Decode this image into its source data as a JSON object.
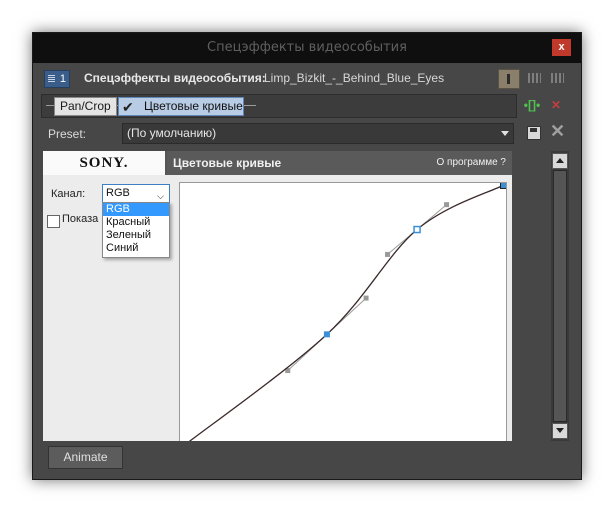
{
  "window": {
    "title": "Спецэффекты видеособытия",
    "close_label": "x"
  },
  "header": {
    "fx_badge_label": "1",
    "title": "Спецэффекты видеособытия:",
    "event_name": "Limp_Bizkit_-_Behind_Blue_Eyes"
  },
  "chain": {
    "plugins": [
      {
        "label": "Pan/Crop"
      },
      {
        "label": "Цветовые кривые"
      }
    ]
  },
  "preset": {
    "label": "Preset:",
    "value": "(По умолчанию)"
  },
  "plugin_panel": {
    "brand": "SONY.",
    "title": "Цветовые кривые",
    "about": "О программе  ?",
    "channel": {
      "label": "Канал:",
      "value": "RGB",
      "options": [
        "RGB",
        "Красный",
        "Зеленый",
        "Синий"
      ]
    },
    "show_checkbox_label": "Показа"
  },
  "curve": {
    "x_range": [
      0,
      1
    ],
    "y_range": [
      0,
      1
    ],
    "control_points": [
      {
        "x": 0.0,
        "y": 0.0
      },
      {
        "x": 0.45,
        "y": 0.43
      },
      {
        "x": 0.73,
        "y": 0.83
      },
      {
        "x": 1.0,
        "y": 1.0
      }
    ],
    "colors": {
      "curve": "#3a2a2a",
      "point": "#3b8fd6",
      "handle": "#9a9a9a"
    }
  },
  "footer": {
    "animate_label": "Animate"
  }
}
